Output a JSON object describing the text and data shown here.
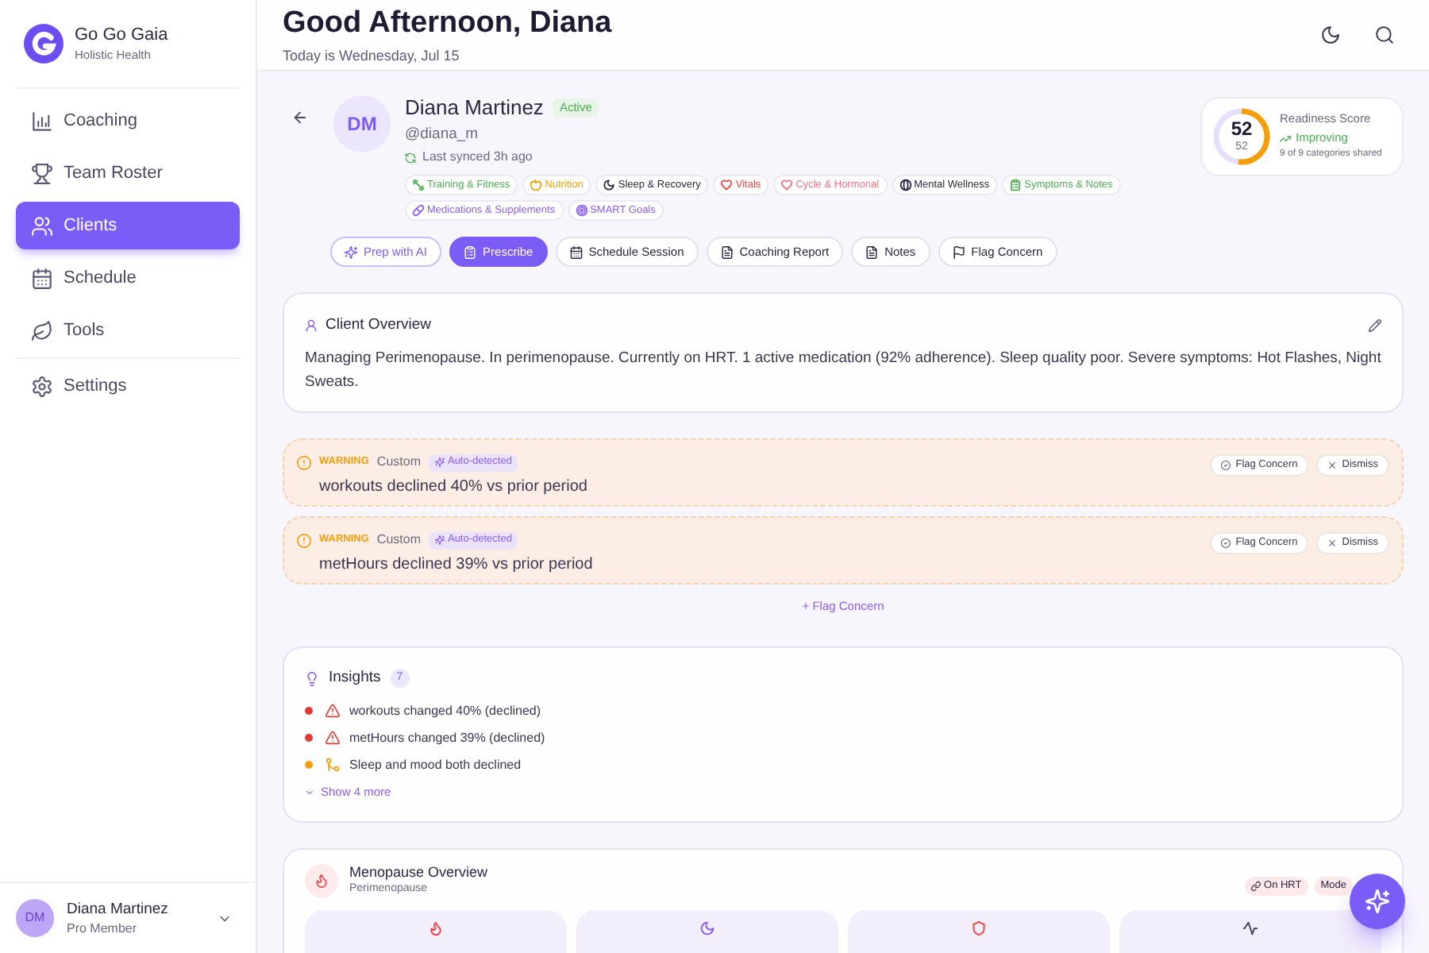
{
  "sidebar": {
    "brand": {
      "name": "Go Go Gaia",
      "tagline": "Holistic Health"
    },
    "nav": [
      {
        "label": "Coaching",
        "selected": false
      },
      {
        "label": "Team Roster",
        "selected": false
      },
      {
        "label": "Clients",
        "selected": true
      },
      {
        "label": "Schedule",
        "selected": false
      },
      {
        "label": "Tools",
        "selected": false
      }
    ],
    "secondary_nav": [
      {
        "label": "Settings",
        "selected": false
      }
    ],
    "user": {
      "initials": "DM",
      "name": "Diana Martinez",
      "role": "Pro Member"
    }
  },
  "header": {
    "title": "Good Afternoon, Diana",
    "subtitle": "Today is Wednesday, Jul 15"
  },
  "client": {
    "initials": "DM",
    "name": "Diana Martinez",
    "status": "Active",
    "handle": "@diana_m",
    "sync": "Last synced 3h ago",
    "categories": [
      {
        "label": "Training & Fitness",
        "color": "#4caf50"
      },
      {
        "label": "Nutrition",
        "color": "#f59e0b"
      },
      {
        "label": "Sleep & Recovery",
        "color": "#2a2540"
      },
      {
        "label": "Vitals",
        "color": "#ef4444"
      },
      {
        "label": "Cycle & Hormonal",
        "color": "#f0717f"
      },
      {
        "label": "Mental Wellness",
        "color": "#2a2540"
      },
      {
        "label": "Symptoms & Notes",
        "color": "#4caf50"
      },
      {
        "label": "Medications & Supplements",
        "color": "#8b5cf6"
      },
      {
        "label": "SMART Goals",
        "color": "#8b5cf6"
      }
    ]
  },
  "readiness": {
    "title": "Readiness Score",
    "score": "52",
    "subscore": "52",
    "level": 0.52,
    "trend": "Improving",
    "shared": "9 of 9 categories shared"
  },
  "actions": [
    {
      "label": "Prep with AI",
      "kind": "ai"
    },
    {
      "label": "Prescribe",
      "kind": "primary"
    },
    {
      "label": "Schedule Session",
      "kind": "default"
    },
    {
      "label": "Coaching Report",
      "kind": "default"
    },
    {
      "label": "Notes",
      "kind": "default"
    },
    {
      "label": "Flag Concern",
      "kind": "default"
    }
  ],
  "overview": {
    "title": "Client Overview",
    "text": "Managing Perimenopause. In perimenopause. Currently on HRT. 1 active medication (92% adherence). Sleep quality poor. Severe symptoms: Hot Flashes, Night Sweats."
  },
  "alerts": [
    {
      "kind": "warning",
      "severity": "WARNING",
      "source": "Custom",
      "tag": "Auto-detected",
      "message": "workouts declined 40% vs prior period",
      "actions": [
        "Flag Concern",
        "Dismiss"
      ]
    },
    {
      "kind": "warning",
      "severity": "WARNING",
      "source": "Custom",
      "tag": "Auto-detected",
      "message": "metHours declined 39% vs prior period",
      "actions": [
        "Flag Concern",
        "Dismiss"
      ]
    }
  ],
  "add_concern": "+ Flag Concern",
  "insights": {
    "title": "Insights",
    "count": "7",
    "items": [
      {
        "kind": "decline",
        "text": "workouts changed 40% (declined)",
        "color": "#e53935"
      },
      {
        "kind": "decline",
        "text": "metHours changed 39% (declined)",
        "color": "#e53935"
      },
      {
        "kind": "correlation",
        "text": "Sleep and mood both declined",
        "color": "#f59e0b"
      }
    ],
    "more": "Show 4 more"
  },
  "menopause": {
    "title": "Menopause Overview",
    "subtitle": "Perimenopause",
    "badges": [
      {
        "label": "On HRT",
        "kind": "medication"
      },
      {
        "label": "Mode",
        "kind": "plain"
      }
    ],
    "tiles": [
      {
        "color": "#ef4444"
      },
      {
        "color": "#8b5cf6"
      },
      {
        "color": "#ef4444"
      },
      {
        "color": "#4b4763"
      }
    ]
  }
}
